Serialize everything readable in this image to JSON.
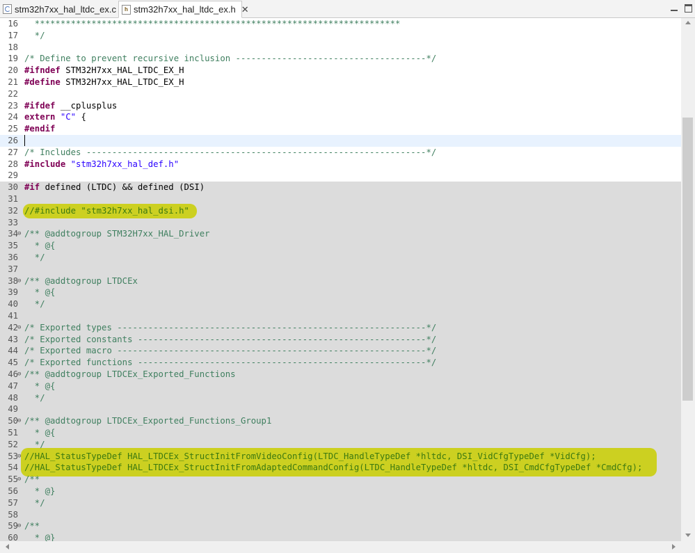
{
  "tabs": [
    {
      "label": "stm32h7xx_hal_ltdc_ex.c",
      "icon": "c-file-icon",
      "active": false
    },
    {
      "label": "stm32h7xx_hal_ltdc_ex.h",
      "icon": "h-file-icon",
      "active": true,
      "close": "✕"
    }
  ],
  "colors": {
    "comment": "#3f7f5f",
    "keyword": "#7f0055",
    "string": "#2a00ff",
    "highlight": "#eaf000",
    "inactive_code_bg": "#dcdcdc",
    "current_line_bg": "#e8f2fe"
  },
  "lines": [
    {
      "n": "16",
      "t": "  ***********************************************************************",
      "k": "comment"
    },
    {
      "n": "17",
      "t": "  */",
      "k": "comment"
    },
    {
      "n": "18",
      "t": "",
      "k": "plain"
    },
    {
      "n": "19",
      "t": "/* Define to prevent recursive inclusion -------------------------------------*/",
      "k": "comment"
    },
    {
      "n": "20",
      "k": "directive",
      "kw": "#ifndef",
      "rest": " STM32H7xx_HAL_LTDC_EX_H"
    },
    {
      "n": "21",
      "k": "directive",
      "kw": "#define",
      "rest": " STM32H7xx_HAL_LTDC_EX_H"
    },
    {
      "n": "22",
      "t": "",
      "k": "plain"
    },
    {
      "n": "23",
      "k": "directive",
      "kw": "#ifdef",
      "rest": " __cplusplus"
    },
    {
      "n": "24",
      "k": "extern",
      "kw": "extern",
      "str": "\"C\"",
      "rest": " {"
    },
    {
      "n": "25",
      "k": "directive",
      "kw": "#endif",
      "rest": ""
    },
    {
      "n": "26",
      "t": "",
      "k": "plain"
    },
    {
      "n": "27",
      "t": "/* Includes ------------------------------------------------------------------*/",
      "k": "comment"
    },
    {
      "n": "28",
      "k": "include",
      "kw": "#include",
      "str": "\"stm32h7xx_hal_def.h\""
    },
    {
      "n": "29",
      "t": "",
      "k": "plain"
    },
    {
      "n": "30",
      "k": "directive",
      "kw": "#if",
      "rest": " defined (LTDC) && defined (DSI)"
    },
    {
      "n": "31",
      "t": "",
      "k": "plain"
    },
    {
      "n": "32",
      "t": "//#include \"stm32h7xx_hal_dsi.h\"",
      "k": "comment"
    },
    {
      "n": "33",
      "t": "",
      "k": "plain"
    },
    {
      "n": "34",
      "t": "/** @addtogroup STM32H7xx_HAL_Driver",
      "k": "comment",
      "fold": "⊖"
    },
    {
      "n": "35",
      "t": "  * @{",
      "k": "comment"
    },
    {
      "n": "36",
      "t": "  */",
      "k": "comment"
    },
    {
      "n": "37",
      "t": "",
      "k": "plain"
    },
    {
      "n": "38",
      "t": "/** @addtogroup LTDCEx",
      "k": "comment",
      "fold": "⊖"
    },
    {
      "n": "39",
      "t": "  * @{",
      "k": "comment"
    },
    {
      "n": "40",
      "t": "  */",
      "k": "comment"
    },
    {
      "n": "41",
      "t": "",
      "k": "plain"
    },
    {
      "n": "42",
      "t": "/* Exported types ------------------------------------------------------------*/",
      "k": "comment",
      "fold": "⊖"
    },
    {
      "n": "43",
      "t": "/* Exported constants --------------------------------------------------------*/",
      "k": "comment"
    },
    {
      "n": "44",
      "t": "/* Exported macro ------------------------------------------------------------*/",
      "k": "comment"
    },
    {
      "n": "45",
      "t": "/* Exported functions --------------------------------------------------------*/",
      "k": "comment"
    },
    {
      "n": "46",
      "t": "/** @addtogroup LTDCEx_Exported_Functions",
      "k": "comment",
      "fold": "⊖"
    },
    {
      "n": "47",
      "t": "  * @{",
      "k": "comment"
    },
    {
      "n": "48",
      "t": "  */",
      "k": "comment"
    },
    {
      "n": "49",
      "t": "",
      "k": "plain"
    },
    {
      "n": "50",
      "t": "/** @addtogroup LTDCEx_Exported_Functions_Group1",
      "k": "comment",
      "fold": "⊖"
    },
    {
      "n": "51",
      "t": "  * @{",
      "k": "comment"
    },
    {
      "n": "52",
      "t": "  */",
      "k": "comment"
    },
    {
      "n": "53",
      "t": "//HAL_StatusTypeDef HAL_LTDCEx_StructInitFromVideoConfig(LTDC_HandleTypeDef *hltdc, DSI_VidCfgTypeDef *VidCfg);",
      "k": "comment",
      "fold": "⊖"
    },
    {
      "n": "54",
      "t": "//HAL_StatusTypeDef HAL_LTDCEx_StructInitFromAdaptedCommandConfig(LTDC_HandleTypeDef *hltdc, DSI_CmdCfgTypeDef *CmdCfg);",
      "k": "comment"
    },
    {
      "n": "55",
      "t": "/**",
      "k": "comment",
      "fold": "⊖"
    },
    {
      "n": "56",
      "t": "  * @}",
      "k": "comment"
    },
    {
      "n": "57",
      "t": "  */",
      "k": "comment"
    },
    {
      "n": "58",
      "t": "",
      "k": "plain"
    },
    {
      "n": "59",
      "t": "/**",
      "k": "comment",
      "fold": "⊖"
    },
    {
      "n": "60",
      "t": "  * @}",
      "k": "comment"
    }
  ]
}
